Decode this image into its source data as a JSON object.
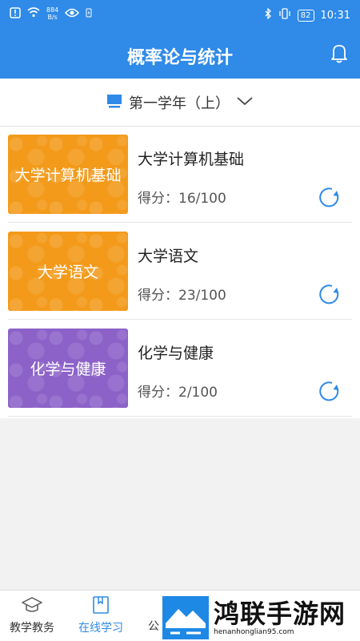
{
  "status_bar": {
    "net_speed_value": "884",
    "net_speed_unit": "B/s",
    "battery": "82",
    "time": "10:31"
  },
  "header": {
    "title": "概率论与统计"
  },
  "semester": {
    "label": "第一学年（上）"
  },
  "courses": [
    {
      "thumb_label": "大学计算机基础",
      "name": "大学计算机基础",
      "score": "得分：16/100",
      "color": "#f39a1a"
    },
    {
      "thumb_label": "大学语文",
      "name": "大学语文",
      "score": "得分：23/100",
      "color": "#f39a1a"
    },
    {
      "thumb_label": "化学与健康",
      "name": "化学与健康",
      "score": "得分：2/100",
      "color": "#8c62c8"
    }
  ],
  "tabs": [
    {
      "label": "教学教务",
      "active": false
    },
    {
      "label": "在线学习",
      "active": true
    },
    {
      "label": "公",
      "active": false
    }
  ],
  "watermark": {
    "title": "鸿联手游网",
    "url": "henanhonglian95.com"
  },
  "colors": {
    "primary": "#2f8ae8",
    "orange": "#f39a1a",
    "purple": "#8c62c8"
  }
}
